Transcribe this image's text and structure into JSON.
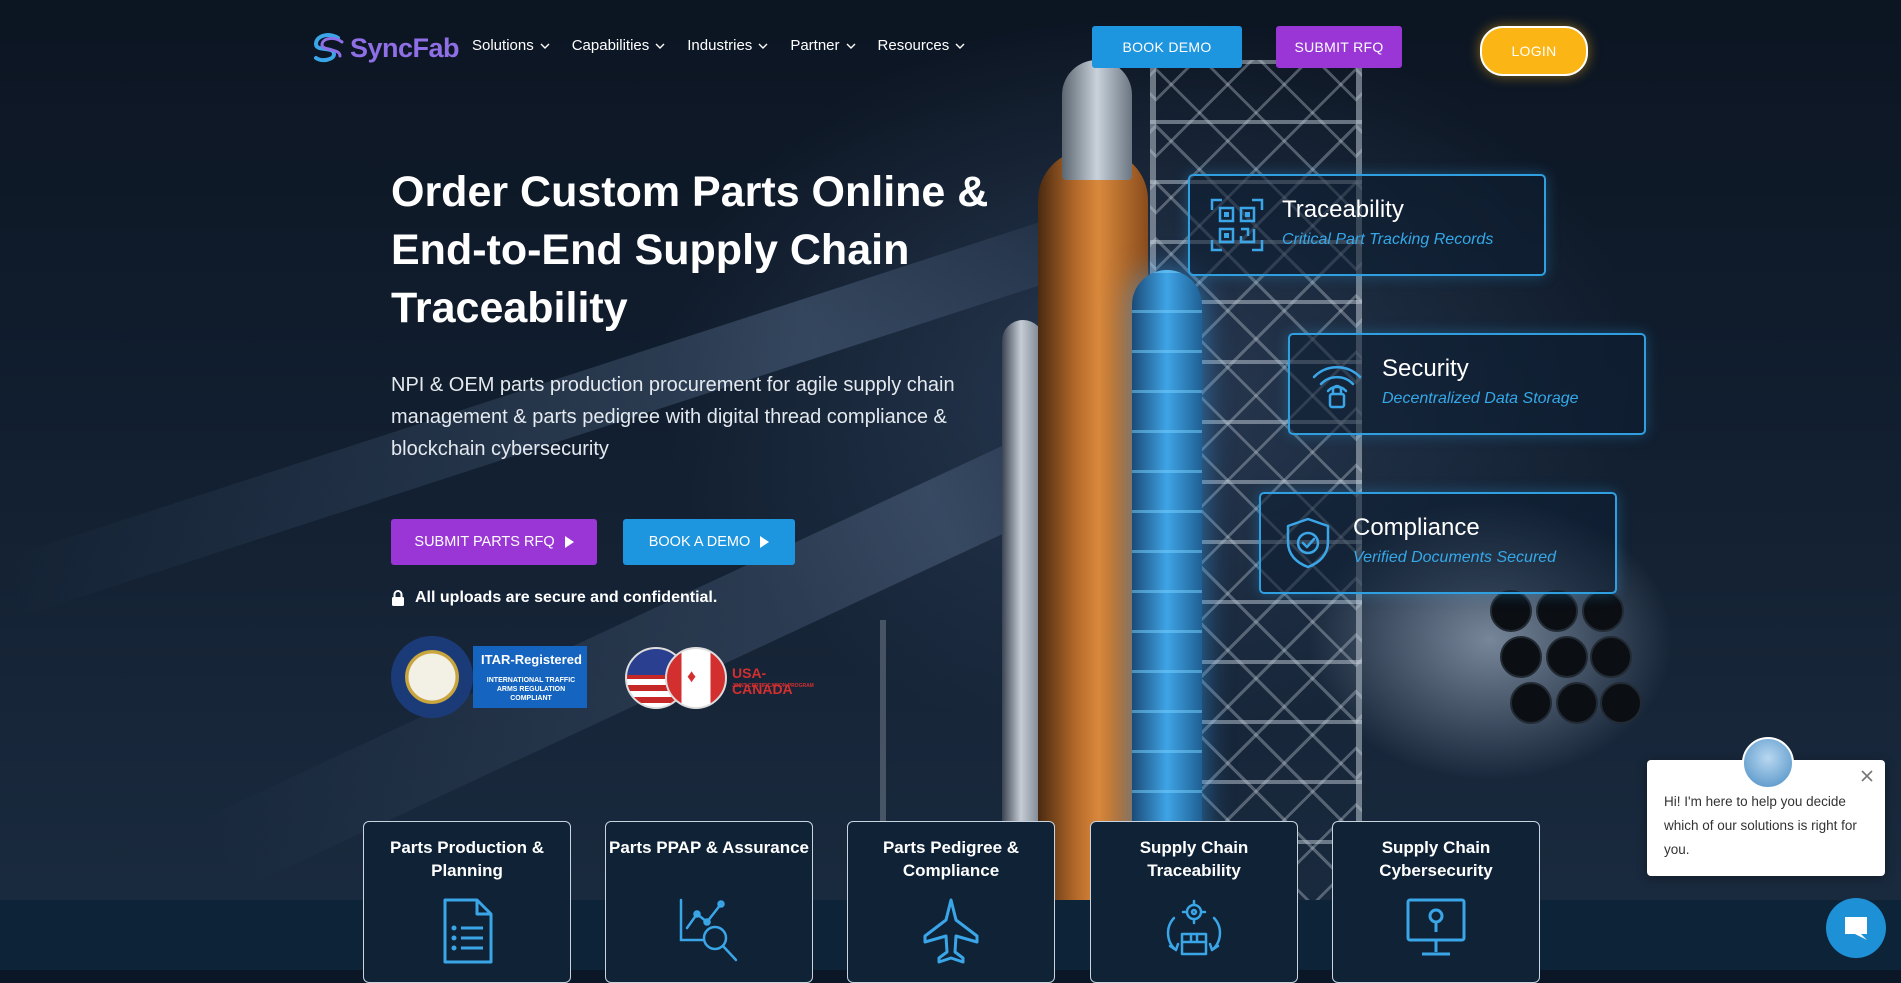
{
  "brand": {
    "logo_text": "SyncFab",
    "accent_purple": "#9b36d6",
    "accent_blue": "#1e95df",
    "accent_yellow": "#fbb514"
  },
  "nav": {
    "items": [
      {
        "label": "Solutions"
      },
      {
        "label": "Capabilities"
      },
      {
        "label": "Industries"
      },
      {
        "label": "Partner"
      },
      {
        "label": "Resources"
      }
    ],
    "book_demo": "BOOK DEMO",
    "submit_rfq": "SUBMIT RFQ",
    "login": "LOGIN"
  },
  "hero": {
    "headline_1": "Order Custom Parts Online &",
    "headline_2": "End-to-End Supply Chain",
    "headline_3": "Traceability",
    "subtext": "NPI & OEM parts production procurement for agile supply chain management & parts pedigree with digital thread compliance & blockchain cybersecurity",
    "cta_rfq": "SUBMIT PARTS RFQ",
    "cta_demo": "BOOK A DEMO",
    "secure_note": "All uploads are secure and confidential."
  },
  "badges": {
    "itar_title": "ITAR-Registered",
    "itar_sub": "INTERNATIONAL TRAFFIC ARMS REGULATION COMPLIANT",
    "usca_title": "USA-CANADA",
    "usca_sub": "JOINT CERTIFICATION PROGRAM"
  },
  "features": [
    {
      "title": "Traceability",
      "subtitle": "Critical Part Tracking Records",
      "icon": "qr-code-icon"
    },
    {
      "title": "Security",
      "subtitle": "Decentralized Data Storage",
      "icon": "wifi-lock-icon"
    },
    {
      "title": "Compliance",
      "subtitle": "Verified Documents Secured",
      "icon": "shield-check-icon"
    }
  ],
  "categories": [
    {
      "title": "Parts Production & Planning",
      "icon": "document-list-icon"
    },
    {
      "title": "Parts PPAP & Assurance",
      "icon": "chart-magnifier-icon"
    },
    {
      "title": "Parts Pedigree & Compliance",
      "icon": "jet-icon"
    },
    {
      "title": "Supply Chain Traceability",
      "icon": "gear-box-cycle-icon"
    },
    {
      "title": "Supply Chain Cybersecurity",
      "icon": "monitor-lock-icon"
    }
  ],
  "chat": {
    "message": "Hi! I'm here to help you decide which of our solutions is right for you."
  }
}
